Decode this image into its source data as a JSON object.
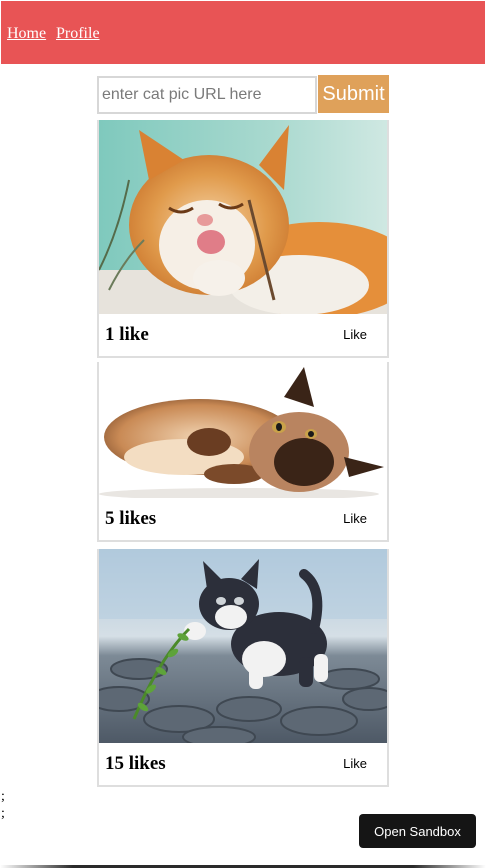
{
  "nav": {
    "home_label": "Home",
    "profile_label": "Profile",
    "background": "#e85455"
  },
  "form": {
    "url_placeholder": "enter cat pic URL here",
    "url_value": "",
    "submit_label": "Submit",
    "submit_color": "#dfa15a"
  },
  "cats": [
    {
      "likes_text": "1 like",
      "like_button": "Like",
      "image_icon": "orange-white-cat-licking-photo"
    },
    {
      "likes_text": "5 likes",
      "like_button": "Like",
      "image_icon": "siamese-cat-lying-photo"
    },
    {
      "likes_text": "15 likes",
      "like_button": "Like",
      "image_icon": "kitten-on-cobblestone-photo"
    }
  ],
  "stray_text": [
    ";",
    ";"
  ],
  "sandbox": {
    "label": "Open Sandbox"
  }
}
